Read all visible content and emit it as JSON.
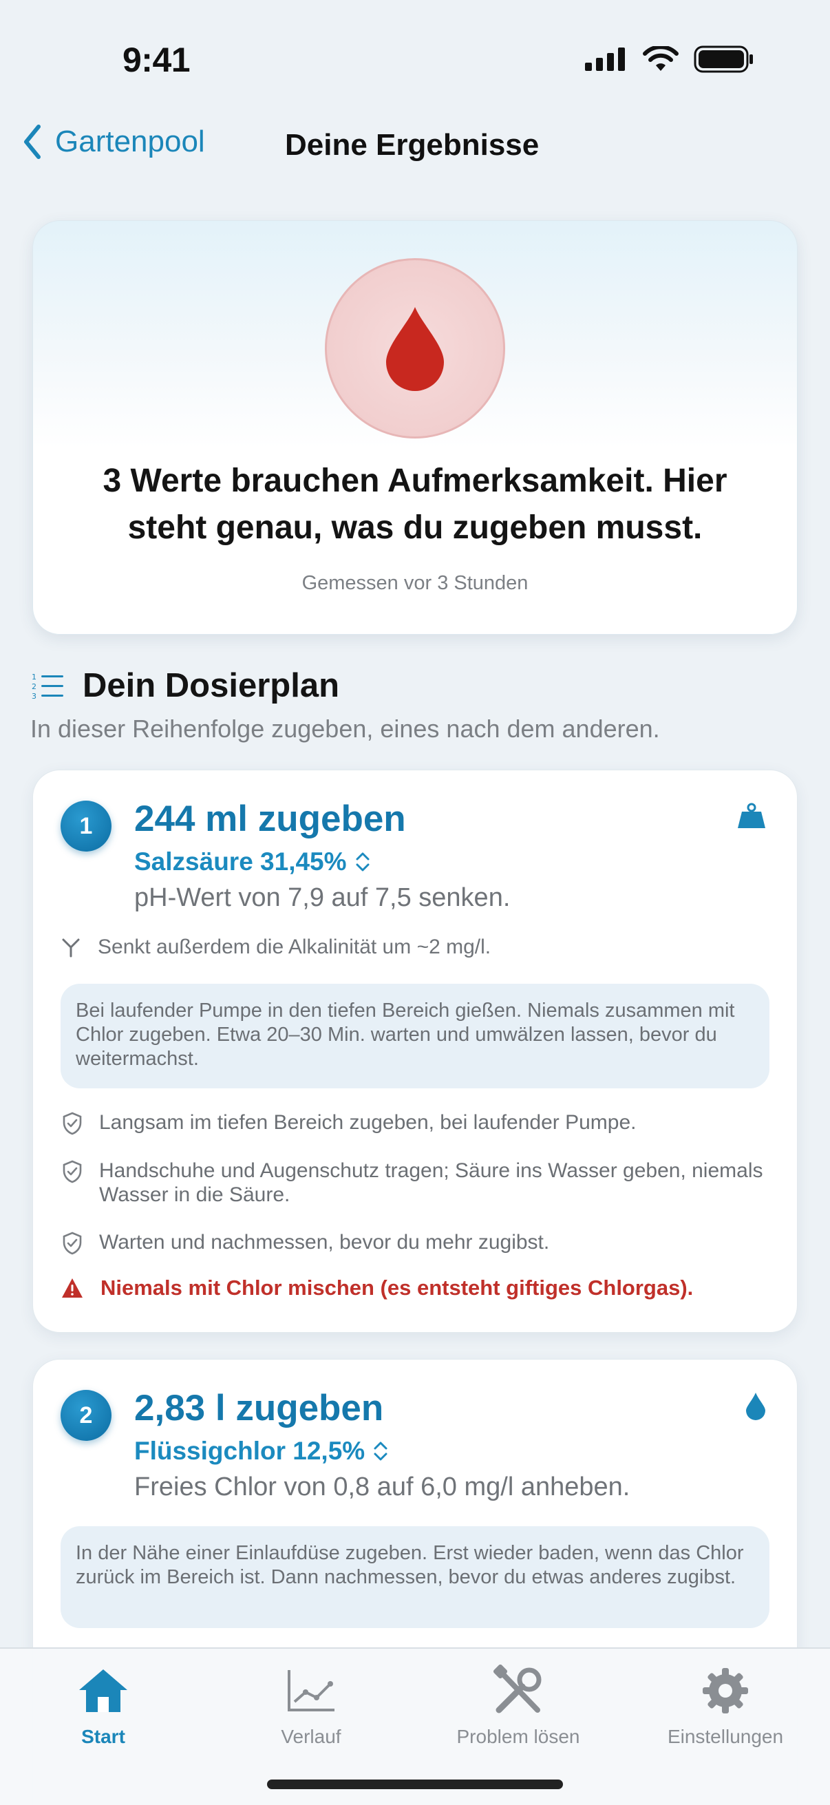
{
  "status_bar": {
    "time": "9:41"
  },
  "nav": {
    "back_label": "Gartenpool",
    "title": "Deine Ergebnisse"
  },
  "hero": {
    "icon": "blood-drop-icon",
    "headline": "3 Werte brauchen Aufmerksamkeit. Hier steht genau, was du zugeben musst.",
    "measured": "Gemessen vor 3 Stunden"
  },
  "section": {
    "title": "Dein Dosierplan",
    "subtitle": "In dieser Reihenfolge zugeben, eines nach dem anderen."
  },
  "steps": [
    {
      "number": "1",
      "amount": "244 ml zugeben",
      "chemical": "Salzsäure 31,45%",
      "goal": "pH-Wert von 7,9 auf 7,5 senken.",
      "icon": "weight-icon",
      "side_effect": "Senkt außerdem die Alkalinität um ~2 mg/l.",
      "instruction": "Bei laufender Pumpe in den tiefen Bereich gießen. Niemals zusammen mit Chlor zugeben. Etwa 20–30 Min. warten und umwälzen lassen, bevor du weitermachst.",
      "checks": [
        "Langsam im tiefen Bereich zugeben, bei laufender Pumpe.",
        "Handschuhe und Augenschutz tragen; Säure ins Wasser geben, niemals Wasser in die Säure.",
        "Warten und nachmessen, bevor du mehr zugibst."
      ],
      "warning": "Niemals mit Chlor mischen (es entsteht giftiges Chlorgas)."
    },
    {
      "number": "2",
      "amount": "2,83 l zugeben",
      "chemical": "Flüssigchlor 12,5%",
      "goal": "Freies Chlor von 0,8 auf 6,0 mg/l anheben.",
      "icon": "water-drop-icon",
      "instruction": "In der Nähe einer Einlaufdüse zugeben. Erst wieder baden, wenn das Chlor zurück im Bereich ist. Dann nachmessen, bevor du etwas anderes zugibst."
    }
  ],
  "tabbar": {
    "tabs": [
      {
        "label": "Start",
        "icon": "home-icon",
        "active": true
      },
      {
        "label": "Verlauf",
        "icon": "chart-icon",
        "active": false
      },
      {
        "label": "Problem lösen",
        "icon": "tools-icon",
        "active": false
      },
      {
        "label": "Einstellungen",
        "icon": "gear-icon",
        "active": false
      }
    ]
  },
  "colors": {
    "accent": "#1b86b9",
    "warning": "#c0302a",
    "drop": "#c8281f"
  }
}
